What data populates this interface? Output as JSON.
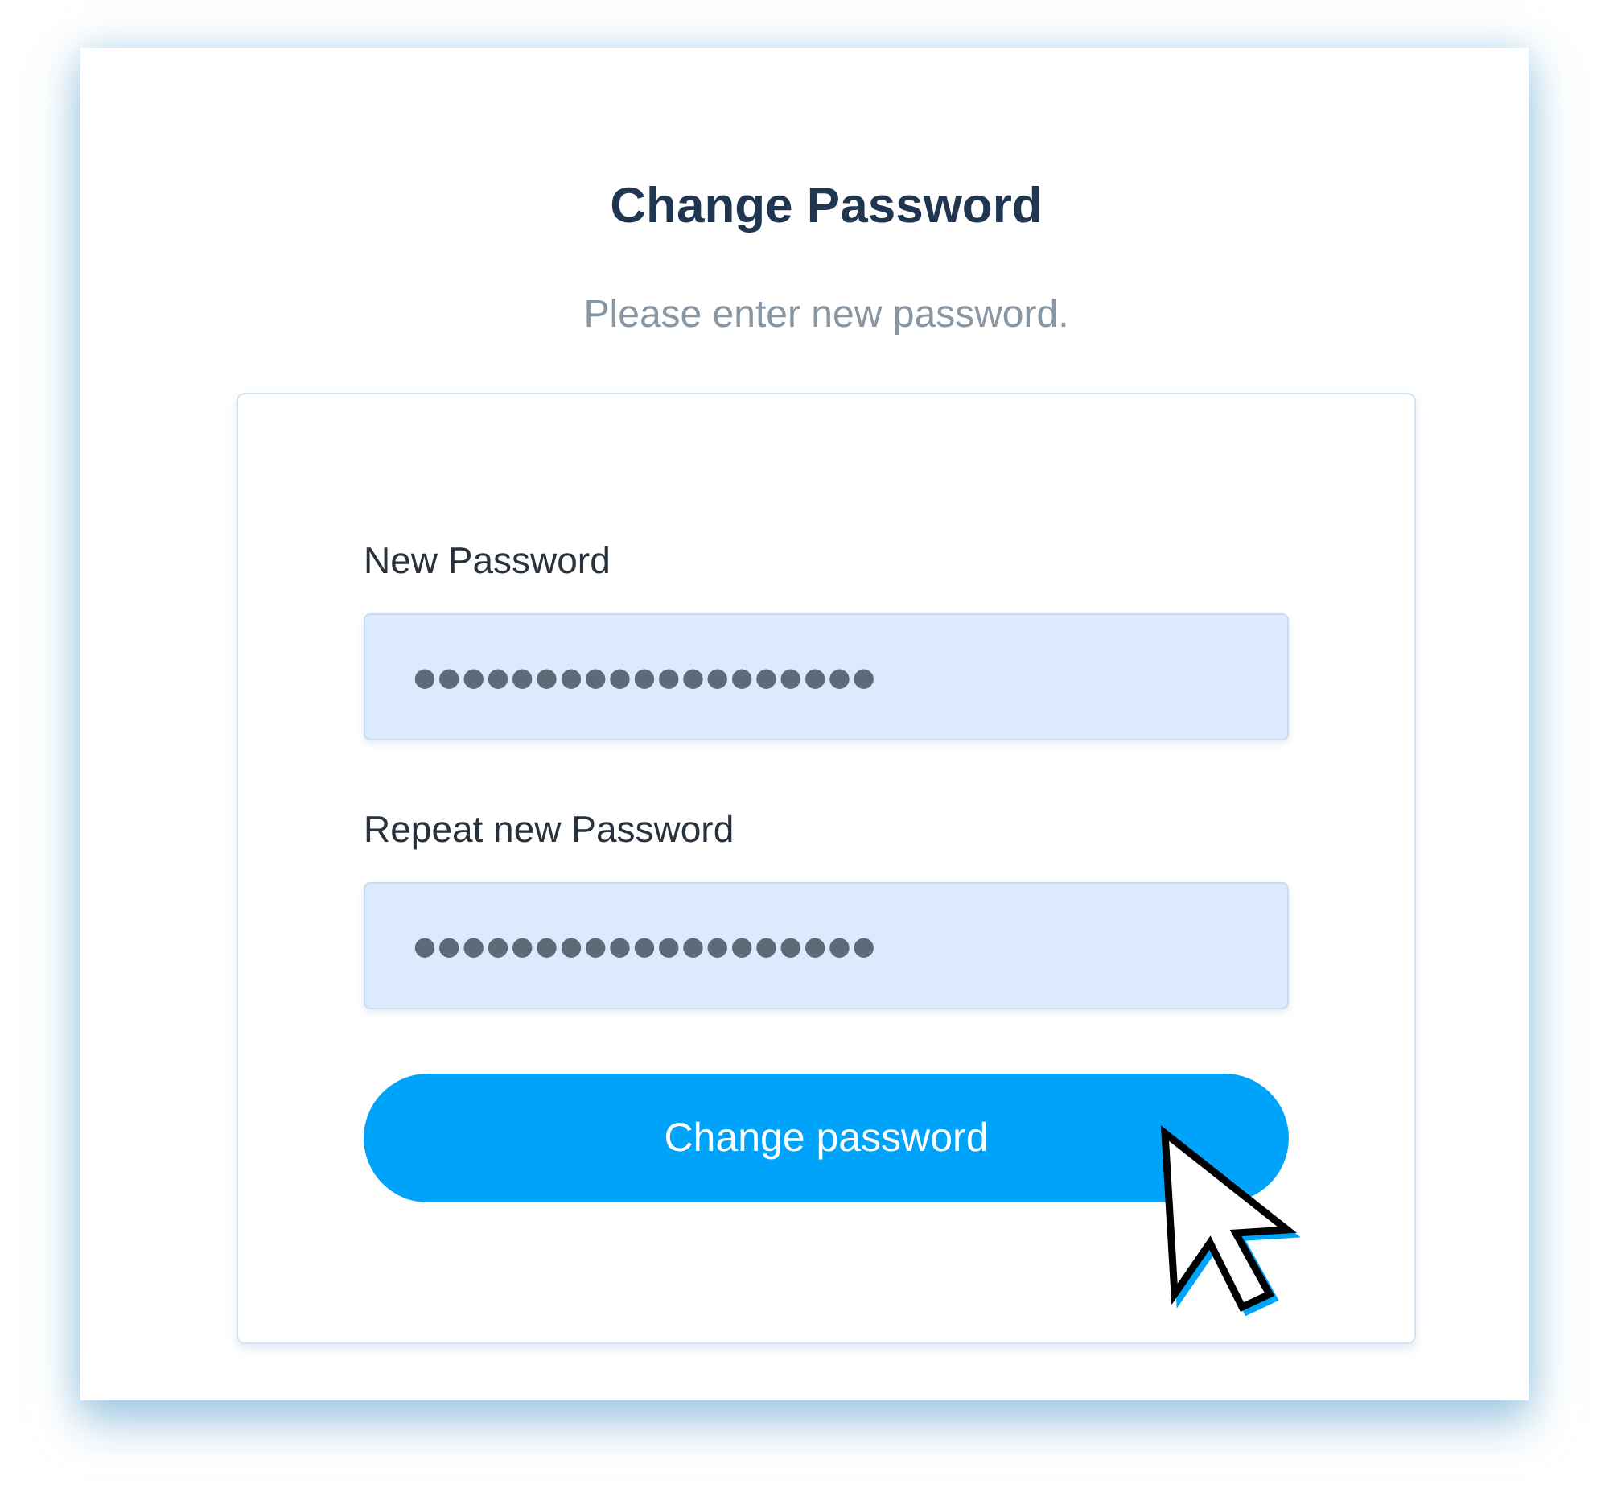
{
  "title": "Change Password",
  "subtitle": "Please enter new password.",
  "form": {
    "fields": [
      {
        "label": "New Password",
        "value": "●●●●●●●●●●●●●●●●●●●"
      },
      {
        "label": "Repeat new Password",
        "value": "●●●●●●●●●●●●●●●●●●●"
      }
    ],
    "submit_button": {
      "label": "Change password"
    }
  }
}
